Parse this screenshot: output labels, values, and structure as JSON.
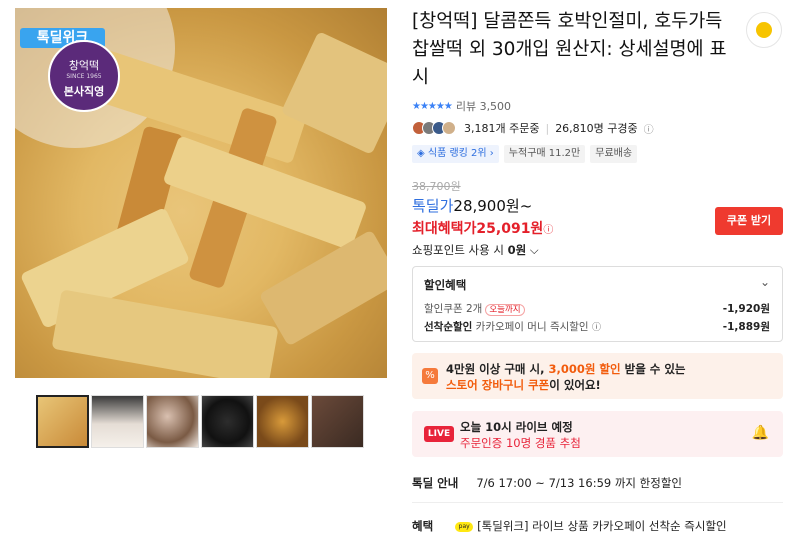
{
  "product": {
    "badge": "톡딜위크",
    "seal": {
      "line1": "창억떡",
      "line2": "SINCE 1965",
      "line3": "본사직영"
    },
    "title": "[창억떡] 달콤쫀득 호박인절미, 호두가득 찹쌀떡 외 30개입 원산지: 상세설명에 표시",
    "rating": {
      "stars": "★★★★★",
      "label": "리뷰 3,500"
    },
    "stats": {
      "orders": "3,181개 주문중",
      "subscribers": "26,810명 구경중"
    },
    "chips": [
      "식품 랭킹 2위",
      "누적구매 11.2만",
      "무료배송"
    ],
    "original_price": "38,700원",
    "deal_label": "톡딜가",
    "deal_price": "28,900원~",
    "max_label": "최대혜택가",
    "max_price": "25,091원",
    "coupon_button": "쿠폰 받기",
    "point_label": "쇼핑포인트 사용 시",
    "point_value": "0원"
  },
  "benefits": {
    "title": "할인혜택",
    "row1": {
      "label": "할인쿠폰 2개",
      "pill": "오늘까지",
      "amount": "-1,920원"
    },
    "row2": {
      "label_bold": "선착순할인",
      "label": "카카오페이 머니 즉시할인",
      "amount": "-1,889원"
    }
  },
  "store_promo": {
    "line1_a": "4만원 이상 구매 시,",
    "line1_hl": "3,000원 할인",
    "line1_b": "받을 수 있는",
    "line2_hl": "스토어 장바구니 쿠폰",
    "line2_b": "이 있어요!"
  },
  "live": {
    "badge": "LIVE",
    "title": "오늘 10시 라이브 예정",
    "subtitle": "주문인증 10명 경품 추첨"
  },
  "deal_info": {
    "label": "톡딜 안내",
    "value": "7/6 17:00 ~ 7/13 16:59 까지 한정할인"
  },
  "benefit_line": {
    "label": "혜택",
    "pay": "pay",
    "value": "[톡딜위크] 라이브 상품 카카오페이 선착순 즉시할인"
  },
  "colors": {
    "accent_blue": "#2f6fdf",
    "red": "#e4202a",
    "coupon": "#ef3a2f",
    "live_bg": "#fdf0f1",
    "store_bg": "#fdf1ea"
  }
}
